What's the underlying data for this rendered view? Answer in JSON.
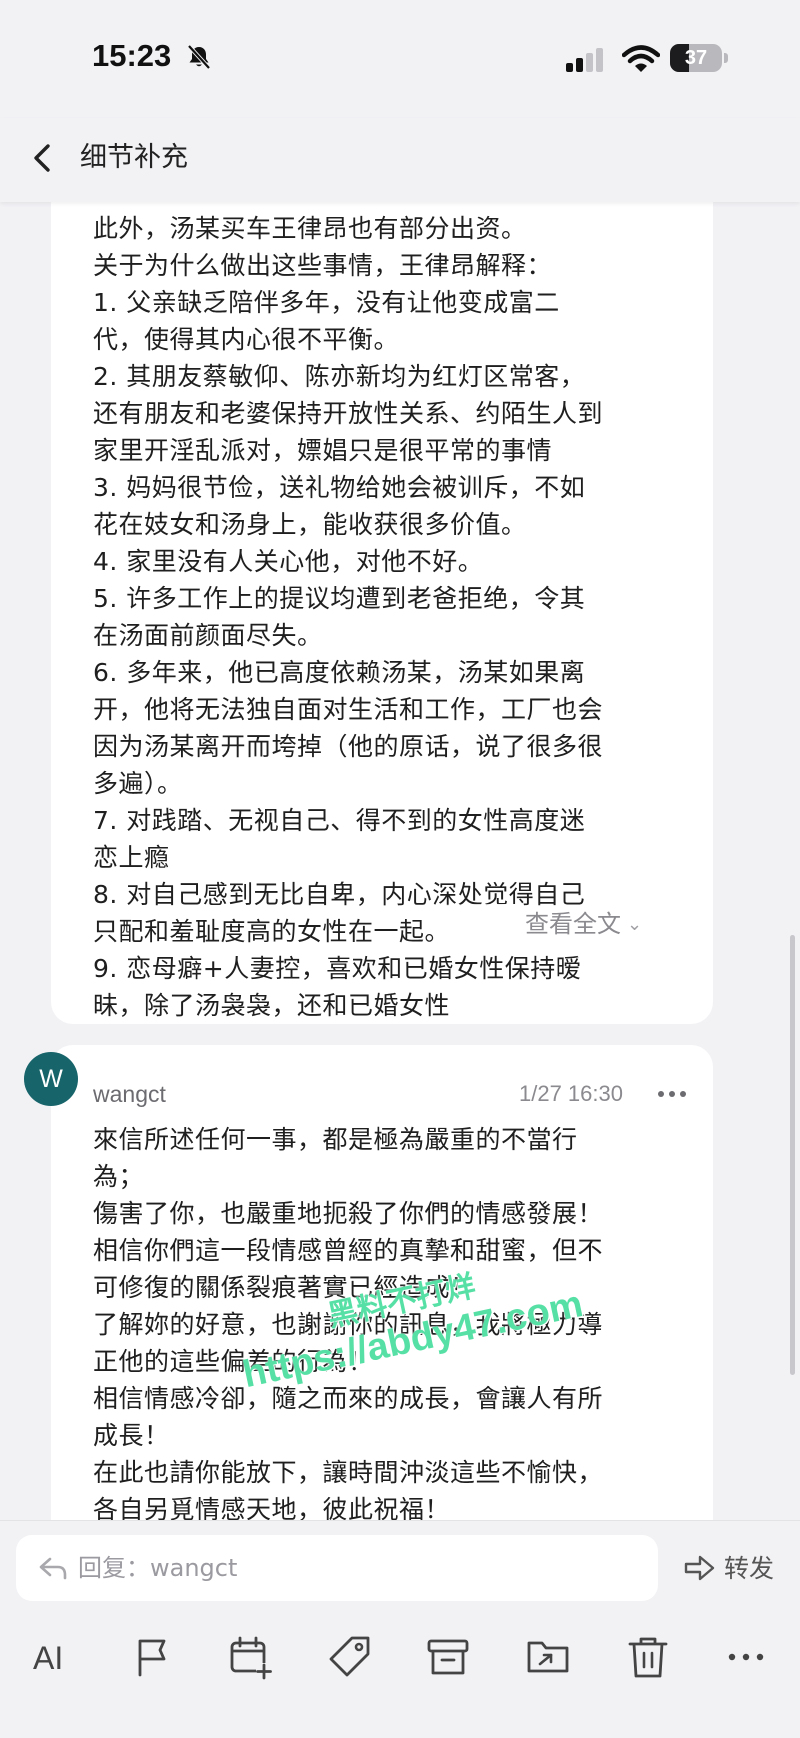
{
  "status_bar": {
    "time": "15:23",
    "battery_level": "37",
    "battery_fraction": 0.37
  },
  "header": {
    "title": "细节补充"
  },
  "message_1": {
    "lines": [
      "此外，汤某买车王律昂也有部分出资。",
      "关于为什么做出这些事情，王律昂解释：",
      "1. 父亲缺乏陪伴多年，没有让他变成富二",
      "代，使得其内心很不平衡。",
      "2. 其朋友蔡敏仰、陈亦新均为红灯区常客，",
      "还有朋友和老婆保持开放性关系、约陌生人到",
      "家里开淫乱派对，嫖娼只是很平常的事情",
      "3. 妈妈很节俭，送礼物给她会被训斥，不如",
      "花在妓女和汤身上，能收获很多价值。",
      "4. 家里没有人关心他，对他不好。",
      "5. 许多工作上的提议均遭到老爸拒绝，令其",
      "在汤面前颜面尽失。",
      "6. 多年来，他已高度依赖汤某，汤某如果离",
      "开，他将无法独自面对生活和工作，工厂也会",
      "因为汤某离开而垮掉（他的原话，说了很多很",
      "多遍）。",
      "7. 对践踏、无视自己、得不到的女性高度迷",
      "恋上瘾",
      "8. 对自己感到无比自卑，内心深处觉得自己",
      "只配和羞耻度高的女性在一起。",
      "9. 恋母癖+人妻控，喜欢和已婚女性保持暧",
      "昧，除了汤袅袅，还和已婚女性"
    ],
    "expand_label": "查看全文"
  },
  "message_2": {
    "avatar_letter": "W",
    "sender": "wangct",
    "time": "1/27 16:30",
    "lines": [
      "來信所述任何一事，都是極為嚴重的不當行",
      "為；",
      "傷害了你，也嚴重地扼殺了你們的情感發展！",
      "相信你們這一段情感曾經的真摯和甜蜜，但不",
      "可修復的關係裂痕著實已經造成！",
      "了解妳的好意，也謝謝你的訊息，我將極力導",
      "正他的這些偏差的行為！",
      "相信情感冷卻，隨之而來的成長，會讓人有所",
      "成長！",
      "在此也請你能放下，讓時間沖淡這些不愉快，",
      "各自另覓情感天地，彼此祝福！"
    ]
  },
  "watermark": {
    "line_1": "黑料不打烊",
    "line_2": "https://abdy47.com"
  },
  "reply_bar": {
    "placeholder": "回复：wangct",
    "forward_label": "转发"
  },
  "toolbar": {
    "ai_label": "AI"
  },
  "colors": {
    "background": "#f2f2f5",
    "card": "#ffffff",
    "avatar": "#17646a",
    "watermark": "#57e0a6",
    "muted_text": "#8a8a8f"
  }
}
